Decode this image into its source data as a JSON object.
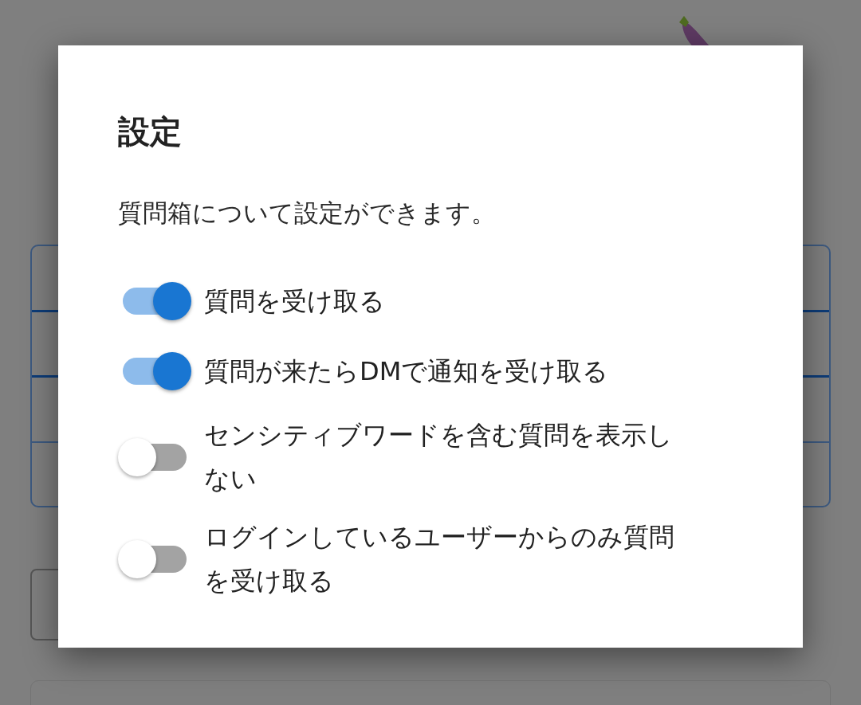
{
  "dialog": {
    "title": "設定",
    "description": "質問箱について設定ができます。",
    "switches": [
      {
        "label": "質問を受け取る",
        "on": true
      },
      {
        "label": "質問が来たらDMで通知を受け取る",
        "on": true
      },
      {
        "label": "センシティブワードを含む質問を表示しない",
        "on": false
      },
      {
        "label": "ログインしているユーザーからのみ質問を受け取る",
        "on": false
      }
    ]
  }
}
